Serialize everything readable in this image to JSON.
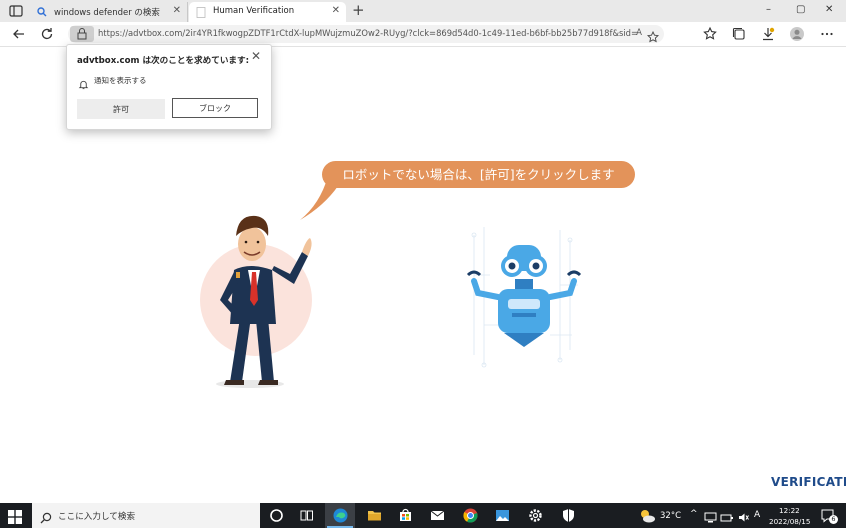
{
  "browser": {
    "tabs": [
      {
        "label": "windows defender の検索",
        "active": false
      },
      {
        "label": "Human Verification",
        "active": true
      }
    ],
    "new_tab": "+",
    "url": "https://advtbox.com/2ir4YR1fkwogpZDTF1rCtdX-lupMWujzmuZOw2-RUyg/?clck=869d54d0-1c49-11ed-b6bf-bb25b77d918f&sid=...",
    "read_aloud": "A",
    "caption": {
      "minimize": "–",
      "maximize": "▢",
      "close": "✕"
    }
  },
  "popup": {
    "title": "advtbox.com は次のことを求めています:",
    "permission": "通知を表示する",
    "allow_label": "許可",
    "block_label": "ブロック",
    "close": "✕"
  },
  "page": {
    "bubble_text": "ロボットでない場合は、[許可]をクリックします",
    "brand": "VERIFICATION",
    "colors": {
      "bubble": "#e3935a",
      "robot": "#4aa8e6",
      "brand": "#1f4b8a"
    }
  },
  "taskbar": {
    "search_placeholder": "ここに入力して検索",
    "temperature": "32°C",
    "time": "12:22",
    "date": "2022/08/15",
    "ime": "A",
    "notification_count": "6",
    "apps": [
      "task-view-icon",
      "edge-icon",
      "file-explorer-icon",
      "store-icon",
      "mail-icon",
      "chrome-icon",
      "photos-icon",
      "settings-icon",
      "security-icon"
    ]
  }
}
